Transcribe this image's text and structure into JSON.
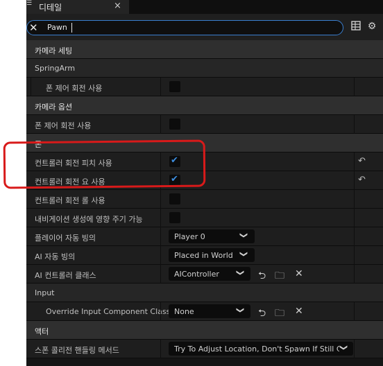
{
  "tab": {
    "title": "디테일"
  },
  "search": {
    "value": "Pawn"
  },
  "sections": {
    "camera_setting": "카메라 세팅",
    "spring_arm": "SpringArm",
    "camera_option": "카메라 옵션",
    "pawn": "폰",
    "input": "Input",
    "actor": "액터"
  },
  "props": {
    "pawn_control_rotation_1": "폰 제어 회전 사용",
    "pawn_control_rotation_2": "폰 제어 회전 사용",
    "controller_pitch": "컨트롤러 회전 피치 사용",
    "controller_yaw": "컨트롤러 회전 요 사용",
    "controller_roll": "컨트롤러 회전 롤 사용",
    "nav_gen": "내비게이션 생성에 영향 주기 가능",
    "auto_possess_player": "플레이어 자동 빙의",
    "auto_possess_ai": "AI 자동 빙의",
    "ai_controller_class": "AI 컨트롤러 클래스",
    "override_input": "Override Input Component Class",
    "spawn_collision": "스폰 콜리전 핸들링 메서드"
  },
  "checks": {
    "pawn_control_rotation_1": false,
    "pawn_control_rotation_2": false,
    "controller_pitch": true,
    "controller_yaw": true,
    "controller_roll": false,
    "nav_gen": false
  },
  "values": {
    "auto_possess_player": "Player 0",
    "auto_possess_ai": "Placed in World",
    "ai_controller_class": "AIController",
    "override_input": "None",
    "spawn_collision": "Try To Adjust Location, Don't Spawn If Still Co"
  },
  "colors": {
    "accent": "#3d8ee0",
    "annotation": "#d81a1a"
  }
}
